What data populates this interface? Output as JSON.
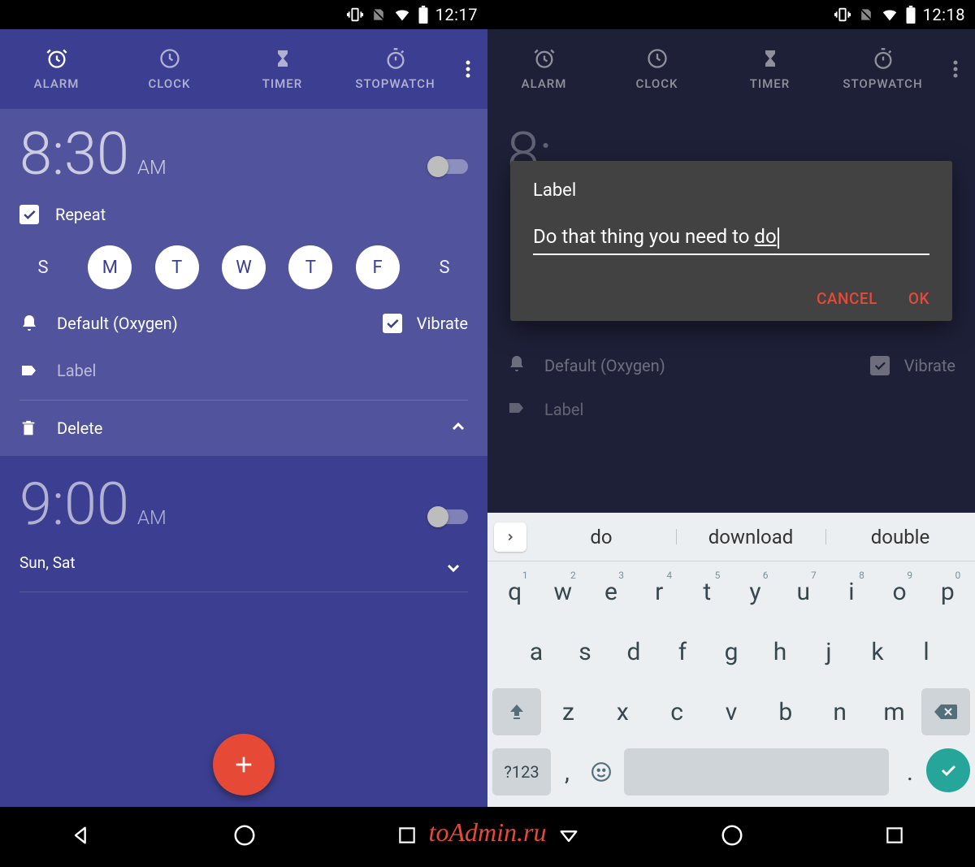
{
  "left": {
    "status_time": "12:17",
    "tabs": [
      {
        "label": "ALARM"
      },
      {
        "label": "CLOCK"
      },
      {
        "label": "TIMER"
      },
      {
        "label": "STOPWATCH"
      }
    ],
    "alarm1": {
      "time": "8:30",
      "ampm": "AM",
      "repeat_label": "Repeat",
      "days": [
        {
          "label": "S",
          "on": false
        },
        {
          "label": "M",
          "on": true
        },
        {
          "label": "T",
          "on": true
        },
        {
          "label": "W",
          "on": true
        },
        {
          "label": "T",
          "on": true
        },
        {
          "label": "F",
          "on": true
        },
        {
          "label": "S",
          "on": false
        }
      ],
      "sound": "Default (Oxygen)",
      "vibrate_label": "Vibrate",
      "label_placeholder": "Label",
      "delete_label": "Delete"
    },
    "alarm2": {
      "time": "9:00",
      "ampm": "AM",
      "days_label": "Sun, Sat"
    }
  },
  "right": {
    "status_time": "12:18",
    "tabs": [
      {
        "label": "ALARM"
      },
      {
        "label": "CLOCK"
      },
      {
        "label": "TIMER"
      },
      {
        "label": "STOPWATCH"
      }
    ],
    "dim": {
      "time": "8:",
      "sound": "Default (Oxygen)",
      "vibrate_label": "Vibrate",
      "label_placeholder": "Label"
    },
    "dialog": {
      "title": "Label",
      "input_value": "Do that thing you need to do",
      "cancel": "CANCEL",
      "ok": "OK"
    },
    "keyboard": {
      "suggestions": [
        "do",
        "download",
        "double"
      ],
      "row1": [
        "q",
        "w",
        "e",
        "r",
        "t",
        "y",
        "u",
        "i",
        "o",
        "p"
      ],
      "row1_sup": [
        "1",
        "2",
        "3",
        "4",
        "5",
        "6",
        "7",
        "8",
        "9",
        "0"
      ],
      "row2": [
        "a",
        "s",
        "d",
        "f",
        "g",
        "h",
        "j",
        "k",
        "l"
      ],
      "row3": [
        "z",
        "x",
        "c",
        "v",
        "b",
        "n",
        "m"
      ],
      "sym_key": "?123",
      "comma": ",",
      "period": "."
    }
  },
  "watermark": "toAdmin.ru"
}
